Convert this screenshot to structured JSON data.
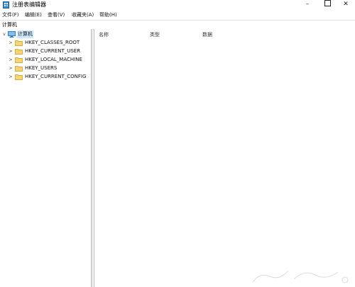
{
  "window": {
    "title": "注册表编辑器",
    "controls": {
      "minimize": "–",
      "maximize": "",
      "close": "✕"
    }
  },
  "menu": {
    "items": [
      "文件(F)",
      "编辑(E)",
      "查看(V)",
      "收藏夹(A)",
      "帮助(H)"
    ]
  },
  "address": {
    "path": "计算机"
  },
  "tree": {
    "root": {
      "label": "计算机",
      "expanded": true,
      "icon": "computer-icon"
    },
    "children": [
      {
        "label": "HKEY_CLASSES_ROOT",
        "icon": "folder-icon"
      },
      {
        "label": "HKEY_CURRENT_USER",
        "icon": "folder-icon"
      },
      {
        "label": "HKEY_LOCAL_MACHINE",
        "icon": "folder-icon"
      },
      {
        "label": "HKEY_USERS",
        "icon": "folder-icon"
      },
      {
        "label": "HKEY_CURRENT_CONFIG",
        "icon": "folder-icon"
      }
    ]
  },
  "list": {
    "columns": [
      "名称",
      "类型",
      "数据"
    ]
  },
  "colors": {
    "selection": "#cce8ff",
    "folder": "#f2d479",
    "folder_border": "#d6ac3c",
    "computer_icon": "#2f7fc1"
  }
}
